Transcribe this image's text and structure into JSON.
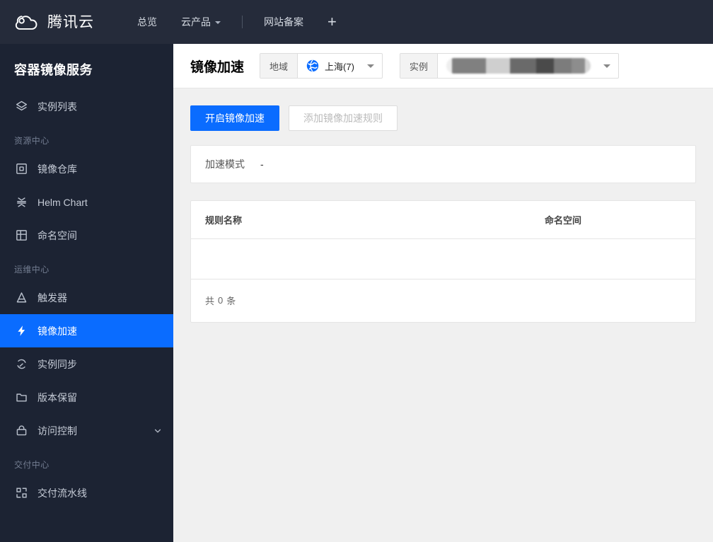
{
  "topbar": {
    "brand": "腾讯云",
    "logo_icon": "tencent-cloud-logo",
    "nav": [
      {
        "label": "总览",
        "has_caret": false,
        "name": "overview"
      },
      {
        "label": "云产品",
        "has_caret": true,
        "name": "cloud-products"
      },
      {
        "label": "网站备案",
        "has_caret": false,
        "name": "icp-filing"
      }
    ],
    "add_label": "+"
  },
  "sidebar": {
    "title": "容器镜像服务",
    "items": [
      {
        "label": "实例列表",
        "icon": "layers-icon",
        "name": "instance-list",
        "type": "item",
        "active": false
      },
      {
        "label": "资源中心",
        "name": "resource-center",
        "type": "group"
      },
      {
        "label": "镜像仓库",
        "icon": "image-repository-icon",
        "name": "image-repository",
        "type": "item",
        "active": false
      },
      {
        "label": "Helm Chart",
        "icon": "helm-chart-icon",
        "name": "helm-chart",
        "type": "item",
        "active": false
      },
      {
        "label": "命名空间",
        "icon": "namespace-grid-icon",
        "name": "namespace",
        "type": "item",
        "active": false
      },
      {
        "label": "运维中心",
        "name": "ops-center",
        "type": "group"
      },
      {
        "label": "触发器",
        "icon": "trigger-icon",
        "name": "trigger",
        "type": "item",
        "active": false
      },
      {
        "label": "镜像加速",
        "icon": "lightning-icon",
        "name": "image-acceleration",
        "type": "item",
        "active": true
      },
      {
        "label": "实例同步",
        "icon": "sync-icon",
        "name": "instance-sync",
        "type": "item",
        "active": false
      },
      {
        "label": "版本保留",
        "icon": "folder-icon",
        "name": "version-retention",
        "type": "item",
        "active": false
      },
      {
        "label": "访问控制",
        "icon": "lock-icon",
        "name": "access-control",
        "type": "item",
        "active": false,
        "expandable": true
      },
      {
        "label": "交付中心",
        "name": "delivery-center",
        "type": "group"
      },
      {
        "label": "交付流水线",
        "icon": "pipeline-icon",
        "name": "delivery-pipeline",
        "type": "item",
        "active": false
      }
    ]
  },
  "page": {
    "title": "镜像加速",
    "region_selector": {
      "label": "地域",
      "value": "上海(7)",
      "icon": "globe-icon"
    },
    "instance_selector": {
      "label": "实例",
      "value": "",
      "redacted": true
    }
  },
  "actions": {
    "enable_acceleration": "开启镜像加速",
    "add_rule": "添加镜像加速规则"
  },
  "info_card": {
    "label": "加速模式",
    "value": "-"
  },
  "table": {
    "columns": [
      {
        "key": "rule_name",
        "label": "规则名称"
      },
      {
        "key": "namespace",
        "label": "命名空间"
      }
    ],
    "rows": [],
    "footer": {
      "prefix": "共",
      "count": "0",
      "suffix": "条"
    }
  },
  "colors": {
    "topbar_bg": "#252b3a",
    "sidebar_bg": "#1c2333",
    "accent_blue": "#0a6cff",
    "page_bg": "#f0f0f0",
    "panel_bg": "#ffffff"
  }
}
